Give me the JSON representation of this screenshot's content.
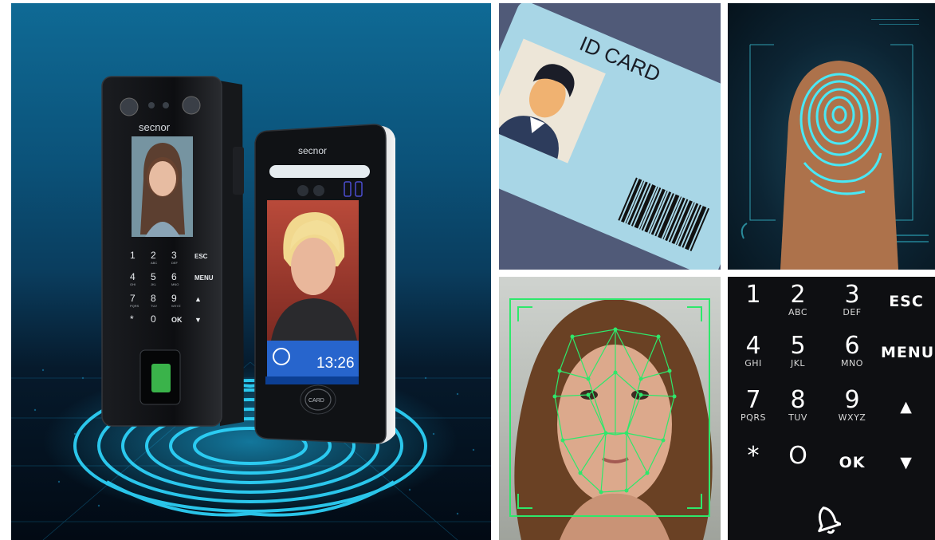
{
  "hero": {
    "device1_brand": "secnor",
    "device2_brand": "secnor",
    "device1_keys": [
      {
        "d": "1",
        "s": ""
      },
      {
        "d": "2",
        "s": "ABC"
      },
      {
        "d": "3",
        "s": "DEF"
      },
      {
        "w": "ESC"
      },
      {
        "d": "4",
        "s": "GHI"
      },
      {
        "d": "5",
        "s": "JKL"
      },
      {
        "d": "6",
        "s": "MNO"
      },
      {
        "w": "MENU"
      },
      {
        "d": "7",
        "s": "PQRS"
      },
      {
        "d": "8",
        "s": "TUV"
      },
      {
        "d": "9",
        "s": "WXYZ"
      },
      {
        "w": "▲"
      },
      {
        "d": "*",
        "s": ""
      },
      {
        "d": "0",
        "s": ""
      },
      {
        "w": "OK"
      },
      {
        "w": "▼"
      }
    ],
    "device2_clock": "13:26",
    "device2_card_label": "CARD"
  },
  "idcard": {
    "label": "ID CARD",
    "card_color": "#a8d6e6"
  },
  "keypad": {
    "keys": [
      {
        "digit": "1",
        "sub": ""
      },
      {
        "digit": "2",
        "sub": "ABC"
      },
      {
        "digit": "3",
        "sub": "DEF"
      },
      {
        "word": "ESC"
      },
      {
        "digit": "4",
        "sub": "GHI"
      },
      {
        "digit": "5",
        "sub": "JKL"
      },
      {
        "digit": "6",
        "sub": "MNO"
      },
      {
        "word": "MENU"
      },
      {
        "digit": "7",
        "sub": "PQRS"
      },
      {
        "digit": "8",
        "sub": "TUV"
      },
      {
        "digit": "9",
        "sub": "WXYZ"
      },
      {
        "word": "▲"
      },
      {
        "digit": "*",
        "sub": ""
      },
      {
        "digit": "O",
        "sub": ""
      },
      {
        "word": "OK"
      },
      {
        "word": "▼"
      }
    ],
    "bell_icon": "bell-icon"
  },
  "colors": {
    "accent_cyan": "#27d6ff",
    "face_mesh_green": "#2ee86b"
  }
}
